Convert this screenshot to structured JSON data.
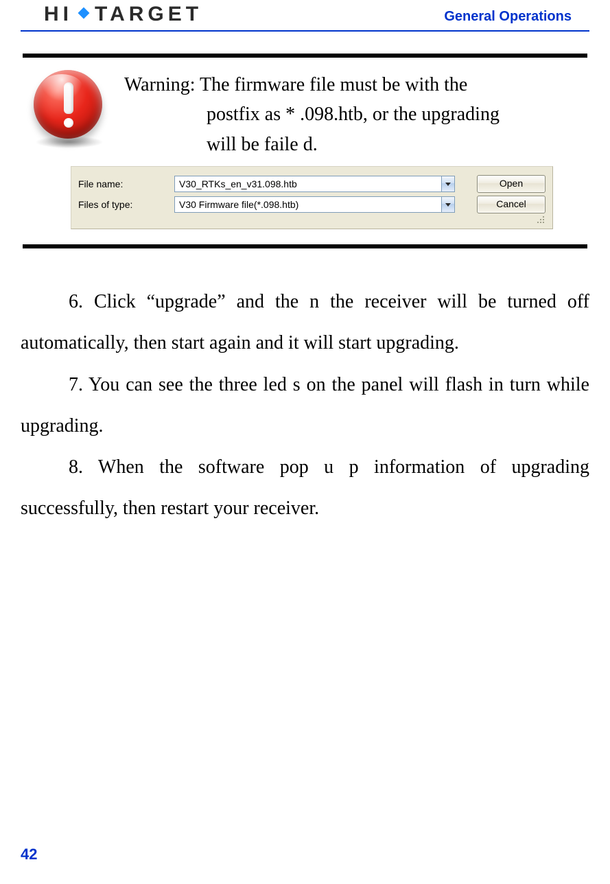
{
  "header": {
    "brand_left": "HI",
    "brand_right": "TARGET",
    "section_title": "General Operations"
  },
  "callout": {
    "warning_line1": "Warning: The firmware file must be with the",
    "warning_line2": "postfix as * .098.htb, or the upgrading",
    "warning_line3": "will be faile d."
  },
  "dialog": {
    "file_name_label": "File name:",
    "file_name_value": "V30_RTKs_en_v31.098.htb",
    "files_type_label": "Files of type:",
    "files_type_value": "V30  Firmware file(*.098.htb)",
    "open_button": "Open",
    "cancel_button": "Cancel"
  },
  "body": {
    "p6": "6. Click “upgrade” and the n the receiver will be turned off automatically, then start again and it will start upgrading.",
    "p7": "7. You can see the three led s on the panel will flash in turn while upgrading.",
    "p8": "8. When the software pop u p information of upgrading successfully, then restart your receiver."
  },
  "page_number": "42"
}
